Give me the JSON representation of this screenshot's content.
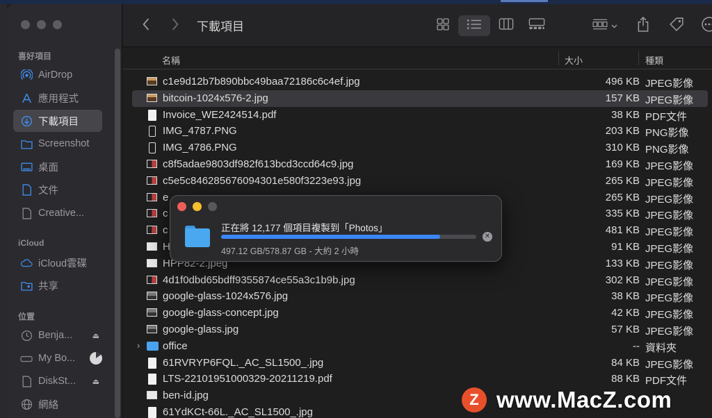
{
  "window": {
    "title": "下載項目"
  },
  "sidebar": {
    "favorites_heading": "喜好項目",
    "icloud_heading": "iCloud",
    "locations_heading": "位置",
    "items": [
      {
        "label": "AirDrop",
        "icon": "airdrop-icon"
      },
      {
        "label": "應用程式",
        "icon": "applications-icon"
      },
      {
        "label": "下載項目",
        "icon": "downloads-icon",
        "active": true
      },
      {
        "label": "Screenshot",
        "icon": "folder-icon"
      },
      {
        "label": "桌面",
        "icon": "desktop-icon"
      },
      {
        "label": "文件",
        "icon": "document-icon"
      },
      {
        "label": "Creative...",
        "icon": "file-icon"
      }
    ],
    "icloud_items": [
      {
        "label": "iCloud雲碟",
        "icon": "cloud-icon"
      },
      {
        "label": "共享",
        "icon": "shared-folder-icon"
      }
    ],
    "location_items": [
      {
        "label": "Benja...",
        "icon": "clock-icon"
      },
      {
        "label": "My Bo...",
        "icon": "drive-icon"
      },
      {
        "label": "DiskSt...",
        "icon": "file-icon"
      },
      {
        "label": "網絡",
        "icon": "network-icon"
      }
    ]
  },
  "list": {
    "columns": {
      "name": "名稱",
      "size": "大小",
      "kind": "種類"
    },
    "rows": [
      {
        "name": "c1e9d12b7b890bbc49baa72186c6c4ef.jpg",
        "size": "496 KB",
        "kind": "JPEG影像",
        "icon": "img"
      },
      {
        "name": "bitcoin-1024x576-2.jpg",
        "size": "157 KB",
        "kind": "JPEG影像",
        "icon": "img",
        "selected": true
      },
      {
        "name": "Invoice_WE2424514.pdf",
        "size": "38 KB",
        "kind": "PDF文件",
        "icon": "doc"
      },
      {
        "name": "IMG_4787.PNG",
        "size": "203 KB",
        "kind": "PNG影像",
        "icon": "png"
      },
      {
        "name": "IMG_4786.PNG",
        "size": "310 KB",
        "kind": "PNG影像",
        "icon": "png"
      },
      {
        "name": "c8f5adae9803df982f613bcd3ccd64c9.jpg",
        "size": "169 KB",
        "kind": "JPEG影像",
        "icon": "img-dark"
      },
      {
        "name": "c5e5c846285676094301e580f3223e93.jpg",
        "size": "265 KB",
        "kind": "JPEG影像",
        "icon": "img-dark"
      },
      {
        "name": "e",
        "size": "265 KB",
        "kind": "JPEG影像",
        "icon": "img-dark"
      },
      {
        "name": "c",
        "size": "335 KB",
        "kind": "JPEG影像",
        "icon": "img-dark"
      },
      {
        "name": "c",
        "size": "481 KB",
        "kind": "JPEG影像",
        "icon": "img-dark"
      },
      {
        "name": "H",
        "size": "91 KB",
        "kind": "JPEG影像",
        "icon": "img-light"
      },
      {
        "name": "HPP82-2.jpeg",
        "size": "133 KB",
        "kind": "JPEG影像",
        "icon": "img-light"
      },
      {
        "name": "4d1f0dbd65bdff9355874ce55a3c1b9b.jpg",
        "size": "302 KB",
        "kind": "JPEG影像",
        "icon": "img-dark"
      },
      {
        "name": "google-glass-1024x576.jpg",
        "size": "38 KB",
        "kind": "JPEG影像",
        "icon": "img-grey"
      },
      {
        "name": "google-glass-concept.jpg",
        "size": "42 KB",
        "kind": "JPEG影像",
        "icon": "img-grey"
      },
      {
        "name": "google-glass.jpg",
        "size": "57 KB",
        "kind": "JPEG影像",
        "icon": "img-grey"
      },
      {
        "name": "office",
        "size": "--",
        "kind": "資料夾",
        "icon": "folder",
        "expandable": true
      },
      {
        "name": "61RVRYP6FQL._AC_SL1500_.jpg",
        "size": "84 KB",
        "kind": "JPEG影像",
        "icon": "doc"
      },
      {
        "name": "LTS-22101951000329-20211219.pdf",
        "size": "88 KB",
        "kind": "PDF文件",
        "icon": "doc"
      },
      {
        "name": "ben-id.jpg",
        "size": "",
        "kind": "",
        "icon": "img-light"
      },
      {
        "name": "61YdKCt-66L._AC_SL1500_.jpg",
        "size": "",
        "kind": "",
        "icon": "doc"
      }
    ]
  },
  "copy_dialog": {
    "title": "正在將 12,177 個項目複製到「Photos」",
    "subtitle": "497.12 GB/578.87 GB - 大約 2 小時",
    "progress": 0.859
  },
  "watermark": {
    "text": "www.MacZ.com",
    "logo": "Z"
  },
  "colors": {
    "accent": "#3a86f5",
    "close": "#ec5f57",
    "minimize": "#f5be2f",
    "zoom": "#57585b",
    "watermark_logo": "#e8502c"
  }
}
